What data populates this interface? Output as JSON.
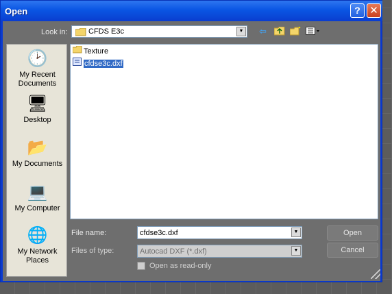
{
  "window": {
    "title": "Open"
  },
  "titlebar": {
    "help_glyph": "?",
    "close_glyph": "✕"
  },
  "lookin": {
    "label": "Look in:",
    "value": "CFDS E3c",
    "icon": "folder-icon"
  },
  "toolbar": {
    "icons": [
      "back-arrow-icon",
      "up-folder-icon",
      "new-folder-icon",
      "view-menu-icon"
    ]
  },
  "places": {
    "items": [
      {
        "label": "My Recent Documents",
        "icon": "recent-documents-icon"
      },
      {
        "label": "Desktop",
        "icon": "desktop-icon"
      },
      {
        "label": "My Documents",
        "icon": "my-documents-icon"
      },
      {
        "label": "My Computer",
        "icon": "my-computer-icon"
      },
      {
        "label": "My Network Places",
        "icon": "network-places-icon"
      }
    ]
  },
  "files": [
    {
      "name": "Texture",
      "icon": "folder-icon",
      "selected": false
    },
    {
      "name": "cfdse3c.dxf",
      "icon": "dxf-file-icon",
      "selected": true
    }
  ],
  "filename": {
    "label": "File name:",
    "value": "cfdse3c.dxf"
  },
  "filetype": {
    "label": "Files of type:",
    "value": "Autocad DXF (*.dxf)"
  },
  "readonly": {
    "label": "Open as read-only",
    "checked": false
  },
  "buttons": {
    "open": "Open",
    "cancel": "Cancel"
  },
  "colors": {
    "titlebar": "#0a55e3",
    "selection": "#316ac5",
    "client": "#6e6e6e"
  }
}
